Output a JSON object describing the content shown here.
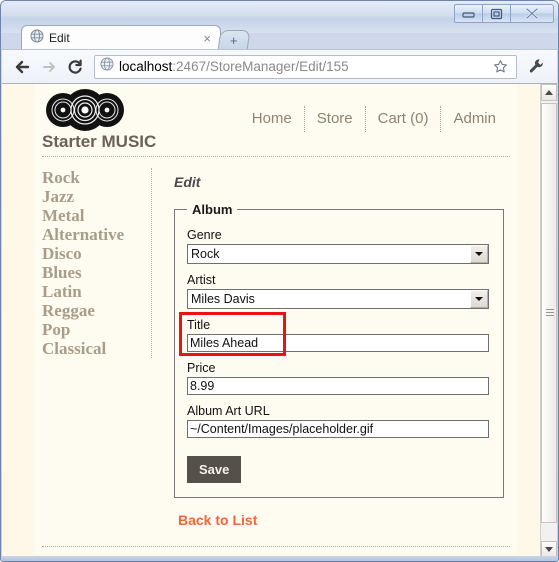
{
  "window": {
    "minimize_label": "Minimize",
    "maximize_label": "Maximize",
    "close_label": "Close"
  },
  "browser": {
    "tab": {
      "title": "Edit",
      "favicon": "globe-icon",
      "close_label": "×"
    },
    "new_tab_label": "+",
    "back_label": "←",
    "forward_label": "→",
    "reload_label": "↻",
    "url": {
      "host": "localhost",
      "rest": ":2467/StoreManager/Edit/155",
      "full": "localhost:2467/StoreManager/Edit/155"
    },
    "bookmark_icon": "star-icon",
    "menu_icon": "wrench-icon"
  },
  "site": {
    "logo": "vinyl-records-logo",
    "title": "Starter MUSIC",
    "nav": [
      {
        "label": "Home"
      },
      {
        "label": "Store"
      },
      {
        "label": "Cart (0)"
      },
      {
        "label": "Admin"
      }
    ]
  },
  "sidebar": {
    "genres": [
      {
        "label": "Rock"
      },
      {
        "label": "Jazz"
      },
      {
        "label": "Metal"
      },
      {
        "label": "Alternative"
      },
      {
        "label": "Disco"
      },
      {
        "label": "Blues"
      },
      {
        "label": "Latin"
      },
      {
        "label": "Reggae"
      },
      {
        "label": "Pop"
      },
      {
        "label": "Classical"
      }
    ]
  },
  "main": {
    "page_title": "Edit",
    "fieldset_legend": "Album",
    "fields": {
      "genre": {
        "label": "Genre",
        "value": "Rock"
      },
      "artist": {
        "label": "Artist",
        "value": "Miles Davis"
      },
      "title": {
        "label": "Title",
        "value": "Miles Ahead"
      },
      "price": {
        "label": "Price",
        "value": "8.99"
      },
      "album_art_url": {
        "label": "Album Art URL",
        "value": "~/Content/Images/placeholder.gif"
      }
    },
    "save_label": "Save",
    "back_link_label": "Back to List"
  },
  "annotation": {
    "highlight_color": "#ee1111",
    "target": "genre-field"
  },
  "colors": {
    "page_background": "#fefbf0",
    "accent_link": "#f3653a",
    "nav_text": "#8e8472",
    "sidebar_text": "#a79d8a",
    "save_button": "#55514a"
  }
}
